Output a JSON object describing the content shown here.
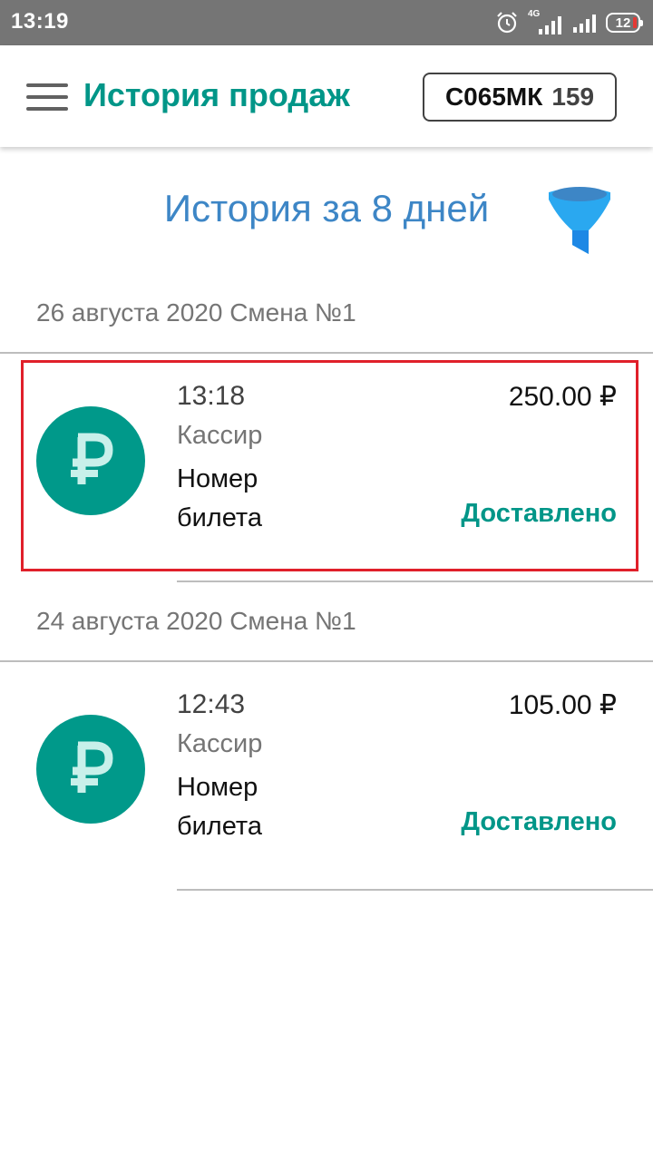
{
  "status_bar": {
    "time": "13:19",
    "network": "4G",
    "battery": "12",
    "icons": [
      "alarm-icon",
      "signal-4g-icon",
      "signal-icon",
      "battery-icon"
    ]
  },
  "app_bar": {
    "title": "История продаж",
    "menu_icon": "menu-icon",
    "plate_number": "С065МК",
    "plate_region": "159"
  },
  "history": {
    "title": "История за 8 дней",
    "filter_icon": "filter-icon"
  },
  "sections": [
    {
      "header": "26 августа 2020 Смена №1",
      "items": [
        {
          "icon": "ruble-icon",
          "time": "13:18",
          "cashier": "Кассир",
          "ticket": "Номер билета",
          "amount": "250.00 ₽",
          "status": "Доставлено"
        }
      ]
    },
    {
      "header": "24 августа 2020 Смена №1",
      "items": [
        {
          "icon": "ruble-icon",
          "time": "12:43",
          "cashier": "Кассир",
          "ticket": "Номер билета",
          "amount": "105.00 ₽",
          "status": "Доставлено"
        }
      ]
    }
  ],
  "colors": {
    "accent": "#009688",
    "title_blue": "#3d86c6",
    "status_bar": "#757575",
    "highlight": "#e0202a"
  }
}
